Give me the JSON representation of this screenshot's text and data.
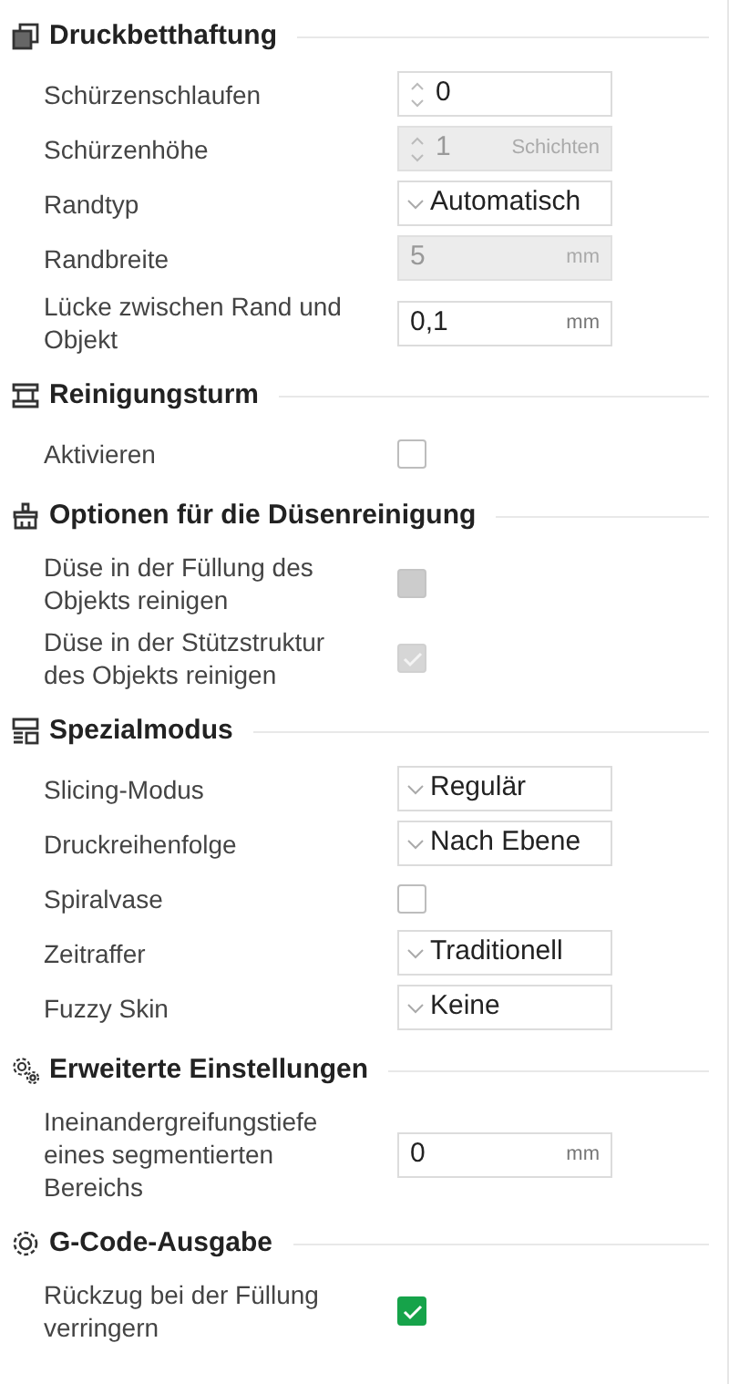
{
  "sections": [
    {
      "title": "Druckbetthaftung",
      "rows": [
        {
          "label": "Schürzenschlaufen",
          "kind": "spin",
          "value": "0",
          "disabled": false
        },
        {
          "label": "Schürzenhöhe",
          "kind": "spin",
          "value": "1",
          "unit": "Schichten",
          "disabled": true
        },
        {
          "label": "Randtyp",
          "kind": "select",
          "value": "Automatisch",
          "disabled": false
        },
        {
          "label": "Randbreite",
          "kind": "number",
          "value": "5",
          "unit": "mm",
          "disabled": true
        },
        {
          "label": "Lücke zwischen Rand und Objekt",
          "kind": "number",
          "value": "0,1",
          "unit": "mm",
          "disabled": false
        }
      ]
    },
    {
      "title": "Reinigungsturm",
      "rows": [
        {
          "label": "Aktivieren",
          "kind": "checkbox",
          "checked": false,
          "disabled": false
        }
      ]
    },
    {
      "title": "Optionen für die Düsenreinigung",
      "rows": [
        {
          "label": "Düse in der Füllung des Objekts reinigen",
          "kind": "checkbox",
          "checked": false,
          "disabled": true
        },
        {
          "label": "Düse in der Stützstruktur des Objekts reinigen",
          "kind": "checkbox",
          "checked": true,
          "disabled": true
        }
      ]
    },
    {
      "title": "Spezialmodus",
      "rows": [
        {
          "label": "Slicing-Modus",
          "kind": "select",
          "value": "Regulär",
          "disabled": false
        },
        {
          "label": "Druckreihenfolge",
          "kind": "select",
          "value": "Nach Ebene",
          "disabled": false
        },
        {
          "label": "Spiralvase",
          "kind": "checkbox",
          "checked": false,
          "disabled": false
        },
        {
          "label": "Zeitraffer",
          "kind": "select",
          "value": "Traditionell",
          "disabled": false
        },
        {
          "label": "Fuzzy Skin",
          "kind": "select",
          "value": "Keine",
          "disabled": false
        }
      ]
    },
    {
      "title": "Erweiterte Einstellungen",
      "rows": [
        {
          "label": "Ineinandergreifungstiefe eines segmentierten Bereichs",
          "kind": "number",
          "value": "0",
          "unit": "mm",
          "disabled": false
        }
      ]
    },
    {
      "title": "G-Code-Ausgabe",
      "rows": [
        {
          "label": "Rückzug bei der Füllung verringern",
          "kind": "checkbox",
          "checked": true,
          "disabled": false
        }
      ]
    }
  ]
}
